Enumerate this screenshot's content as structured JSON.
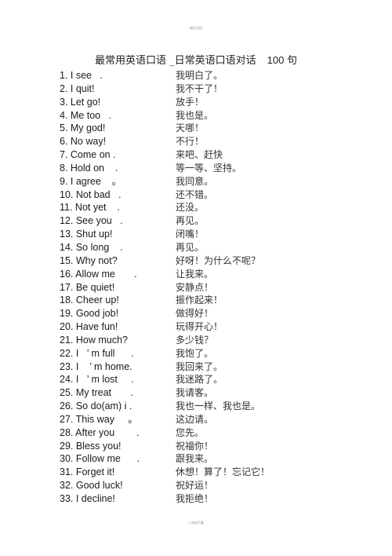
{
  "header": {
    "text": "精品文档"
  },
  "title": {
    "main": "最常用英语口语 _日常英语口语对话",
    "count": "100 句"
  },
  "rows": [
    {
      "en": "1. I see   .",
      "zh": "我明白了。"
    },
    {
      "en": "2. I quit!",
      "zh": "我不干了！"
    },
    {
      "en": "3. Let go!",
      "zh": "放手！"
    },
    {
      "en": "4. Me too   .",
      "zh": "我也是。"
    },
    {
      "en": "5. My god!",
      "zh": "天哪！"
    },
    {
      "en": "6. No way!",
      "zh": "不行！"
    },
    {
      "en": "7. Come on .",
      "zh": "来吧、赶快"
    },
    {
      "en": "8. Hold on    .",
      "zh": "等一等、坚持。"
    },
    {
      "en": "9. I agree    。",
      "zh": "我同意。"
    },
    {
      "en": "10. Not bad   .",
      "zh": "还不错。"
    },
    {
      "en": "11. Not yet    .",
      "zh": "还没。"
    },
    {
      "en": "12. See you   .",
      "zh": "再见。"
    },
    {
      "en": "13. Shut up!",
      "zh": "闭嘴！"
    },
    {
      "en": "14. So long    .",
      "zh": "再见。"
    },
    {
      "en": "15. Why not?",
      "zh": "好呀！为什么不呢？"
    },
    {
      "en": "16. Allow me       .",
      "zh": "让我来。"
    },
    {
      "en": "17. Be quiet!",
      "zh": "安静点！"
    },
    {
      "en": "18. Cheer up!",
      "zh": "振作起来！"
    },
    {
      "en": "19. Good job!",
      "zh": "做得好！"
    },
    {
      "en": "20. Have fun!",
      "zh": "玩得开心！"
    },
    {
      "en": "21. How much?",
      "zh": "多少钱？"
    },
    {
      "en": "22. I   ’ m full      .",
      "zh": "我饱了。"
    },
    {
      "en": "23. I    ’ m home.",
      "zh": "我回来了。"
    },
    {
      "en": "24. I   ’ m lost     .",
      "zh": "我迷路了。"
    },
    {
      "en": "25. My treat       .",
      "zh": "我请客。"
    },
    {
      "en": "26. So do(am) i .",
      "zh": "我也一样、我也是。"
    },
    {
      "en": "27. This way     。",
      "zh": "这边请。"
    },
    {
      "en": "28. After you        .",
      "zh": "您先。"
    },
    {
      "en": "29. Bless you!",
      "zh": "祝福你！"
    },
    {
      "en": "30. Follow me      .",
      "zh": "跟我来。"
    },
    {
      "en": "31. Forget it!",
      "zh": "休想！算了！忘记它！"
    },
    {
      "en": "32. Good luck!",
      "zh": "祝好运！"
    },
    {
      "en": "33. I decline!",
      "zh": "我拒绝！"
    }
  ],
  "footer": {
    "text": "1 欢迎下载"
  }
}
